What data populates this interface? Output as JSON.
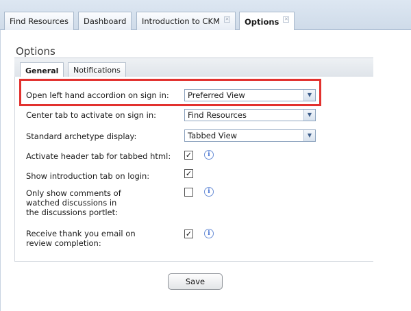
{
  "top_tabs": [
    {
      "label": "Find Resources"
    },
    {
      "label": "Dashboard"
    },
    {
      "label": "Introduction to CKM"
    },
    {
      "label": "Options"
    }
  ],
  "options_title": "Options",
  "inner_tabs": [
    {
      "label": "General"
    },
    {
      "label": "Notifications"
    }
  ],
  "settings": {
    "accordion": {
      "label": "Open left hand accordion on sign in:",
      "value": "Preferred View"
    },
    "center_tab": {
      "label": "Center tab to activate on sign in:",
      "value": "Find Resources"
    },
    "archetype_display": {
      "label": "Standard archetype display:",
      "value": "Tabbed View"
    },
    "header_tab": {
      "label": "Activate header tab for tabbed html:",
      "checked": true
    },
    "intro_tab": {
      "label": "Show introduction tab on login:",
      "checked": true
    },
    "watched_comments": {
      "label": "Only show comments of watched discussions in the discussions portlet:",
      "checked": false
    },
    "thank_you_email": {
      "label": "Receive thank you email on review completion:",
      "checked": true
    }
  },
  "save_label": "Save",
  "colors": {
    "highlight": "#e2312e",
    "info_icon": "#3b6ad1",
    "tab_bar": "#d5e0ec"
  },
  "icons": {
    "close": "close-icon",
    "dropdown": "chevron-down-icon",
    "info": "info-icon",
    "check": "checkmark-icon"
  }
}
